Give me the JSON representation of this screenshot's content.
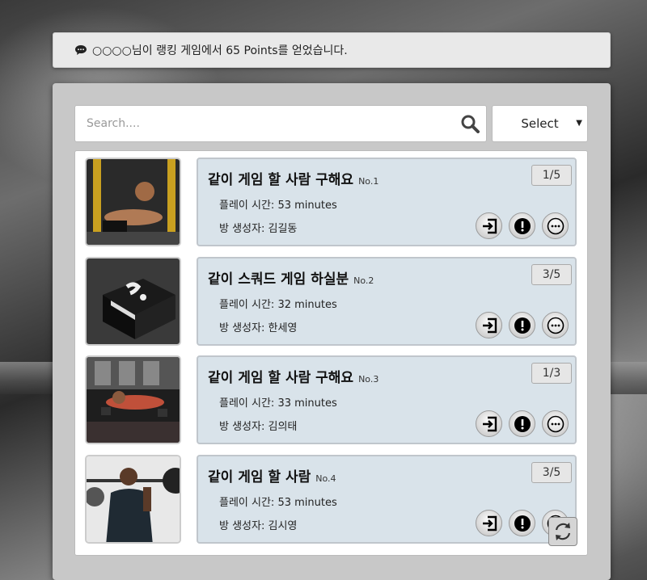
{
  "notice": {
    "text": "○○○○님이 랭킹 게임에서 65 Points를 얻었습니다."
  },
  "search": {
    "placeholder": "Search...."
  },
  "select": {
    "label": "Select"
  },
  "rooms": [
    {
      "title": "같이 게임 할 사람 구해요",
      "no": "No.1",
      "count": "1/5",
      "playtime": "플레이 시간: 53 minutes",
      "creator": "방 생성자: 김길동",
      "thumb": "situp-photo"
    },
    {
      "title": "같이 스쿼드 게임 하실분",
      "no": "No.2",
      "count": "3/5",
      "playtime": "플레이 시간: 32 minutes",
      "creator": "방 생성자: 한세영",
      "thumb": "box-photo"
    },
    {
      "title": "같이 게임 할 사람 구해요",
      "no": "No.3",
      "count": "1/3",
      "playtime": "플레이 시간: 33 minutes",
      "creator": "방 생성자: 김의태",
      "thumb": "pushup-photo"
    },
    {
      "title": "같이 게임 할 사람",
      "no": "No.4",
      "count": "3/5",
      "playtime": "플레이 시간: 53 minutes",
      "creator": "방 생성자: 김시영",
      "thumb": "squat-photo"
    }
  ],
  "icons": {
    "notice": "chat-icon",
    "search": "search-icon",
    "enter": "enter-icon",
    "report": "exclamation-icon",
    "more": "more-icon",
    "refresh": "refresh-icon"
  }
}
